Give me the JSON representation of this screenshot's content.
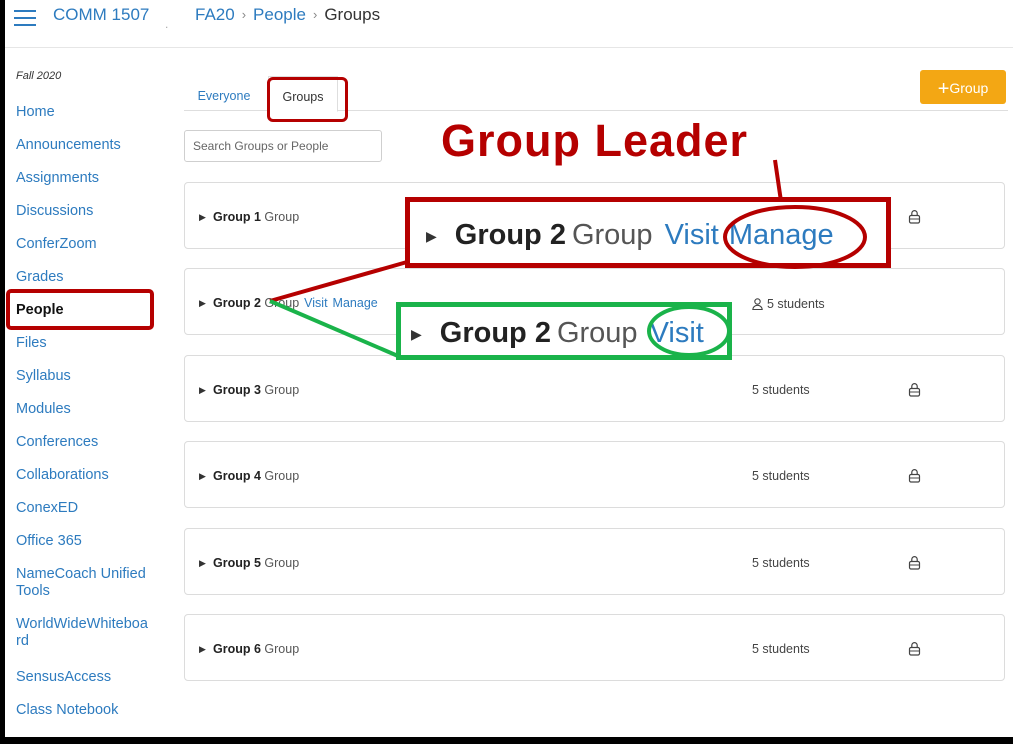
{
  "header": {
    "course_code": "COMM 1507",
    "dot": ".",
    "breadcrumb": [
      "FA20",
      "People",
      "Groups"
    ]
  },
  "sidebar": {
    "term": "Fall 2020",
    "items": [
      {
        "label": "Home"
      },
      {
        "label": "Announcements"
      },
      {
        "label": "Assignments"
      },
      {
        "label": "Discussions"
      },
      {
        "label": "ConferZoom"
      },
      {
        "label": "Grades"
      },
      {
        "label": "People",
        "active": true
      },
      {
        "label": "Files"
      },
      {
        "label": "Syllabus"
      },
      {
        "label": "Modules"
      },
      {
        "label": "Conferences"
      },
      {
        "label": "Collaborations"
      },
      {
        "label": "ConexED"
      },
      {
        "label": "Office 365"
      },
      {
        "label": "NameCoach Unified Tools"
      },
      {
        "label": "WorldWideWhiteboard"
      },
      {
        "label": "SensusAccess"
      },
      {
        "label": "Class Notebook"
      }
    ]
  },
  "tabs": [
    {
      "label": "Everyone"
    },
    {
      "label": "Groups",
      "active": true
    }
  ],
  "add_group_button": {
    "icon": "plus-icon",
    "label": "Group"
  },
  "search": {
    "placeholder": "Search Groups or People"
  },
  "groups": [
    {
      "name": "Group 1",
      "type": "Group",
      "count": "",
      "locked": true
    },
    {
      "name": "Group 2",
      "type": "Group",
      "visit": "Visit",
      "manage": "Manage",
      "count": "5 students",
      "locked": false
    },
    {
      "name": "Group 3",
      "type": "Group",
      "count": "5 students",
      "locked": true
    },
    {
      "name": "Group 4",
      "type": "Group",
      "count": "5 students",
      "locked": true
    },
    {
      "name": "Group 5",
      "type": "Group",
      "count": "5 students",
      "locked": true
    },
    {
      "name": "Group 6",
      "type": "Group",
      "count": "5 students",
      "locked": true
    }
  ],
  "annotation": {
    "title": "Group Leader",
    "leader_view": {
      "name": "Group 2",
      "type": "Group",
      "visit": "Visit",
      "manage": "Manage"
    },
    "member_view": {
      "name": "Group 2",
      "type": "Group",
      "visit": "Visit"
    },
    "colors": {
      "leader": "#b50000",
      "member": "#1ab34a",
      "link": "#2d7bbf",
      "button": "#f3a714"
    }
  }
}
